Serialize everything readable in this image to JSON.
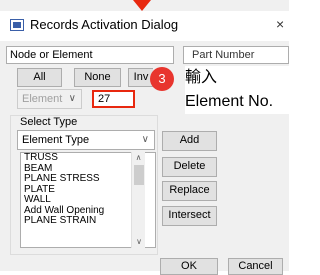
{
  "window": {
    "title": "Records Activation Dialog",
    "close_glyph": "×"
  },
  "node_panel": {
    "label": "Node or Element"
  },
  "part_panel": {
    "label": "Part Number"
  },
  "buttons": {
    "all": "All",
    "none": "None",
    "invert": "Inv",
    "add": "Add",
    "delete": "Delete",
    "replace": "Replace",
    "intersect": "Intersect",
    "ok": "OK",
    "cancel": "Cancel"
  },
  "element_combo": {
    "value": "Element"
  },
  "id_input": {
    "value": "27"
  },
  "select_type": {
    "label": "Select Type",
    "combo_value": "Element Type",
    "list": [
      "TRUSS",
      "BEAM",
      "PLANE STRESS",
      "PLATE",
      "WALL",
      "Add Wall Opening",
      "PLANE STRAIN"
    ]
  },
  "callout": {
    "number": "3",
    "line1": "輸入",
    "line2": "Element No."
  },
  "colors": {
    "callout_red": "#e8352e",
    "highlight_red": "#e8280f"
  }
}
